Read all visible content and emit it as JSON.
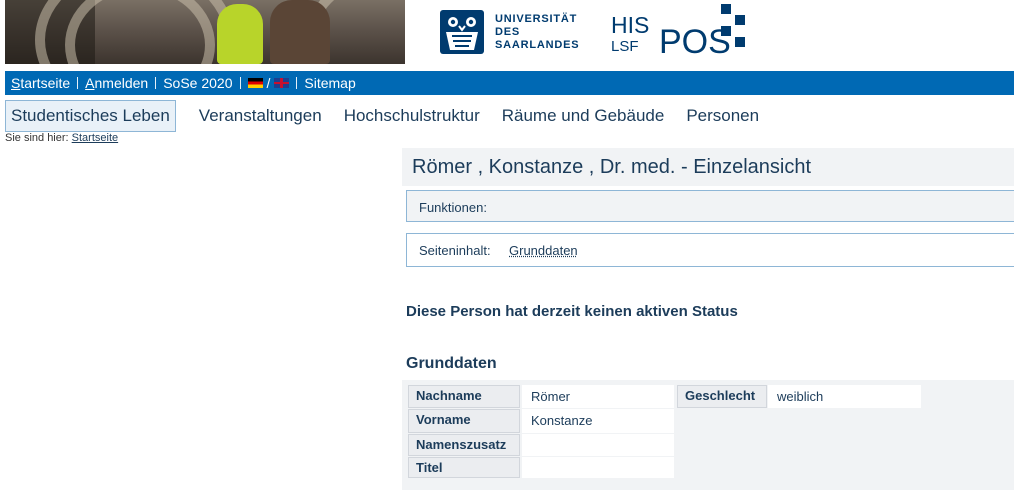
{
  "header": {
    "university_name_lines": [
      "UNIVERSITÄT",
      "DES",
      "SAARLANDES"
    ],
    "system_logo": {
      "his": "HIS",
      "lsf": "LSF",
      "pos": "POS"
    }
  },
  "topnav": {
    "home": {
      "first": "S",
      "rest": "tartseite"
    },
    "login": {
      "first": "A",
      "rest": "nmelden"
    },
    "semester": "SoSe 2020",
    "language_separator": "/",
    "sitemap": "Sitemap"
  },
  "mainnav": {
    "tabs": [
      "Studentisches Leben",
      "Veranstaltungen",
      "Hochschulstruktur",
      "Räume und Gebäude",
      "Personen"
    ]
  },
  "breadcrumb": {
    "prefix": "Sie sind hier:",
    "link": "Startseite"
  },
  "page": {
    "title": "Römer , Konstanze , Dr. med. - Einzelansicht",
    "functions_label": "Funktionen:",
    "content_label": "Seiteninhalt:",
    "content_link": "Grunddaten",
    "status_text": "Diese Person hat derzeit keinen aktiven Status",
    "section_heading": "Grunddaten"
  },
  "grunddaten": {
    "nachname_label": "Nachname",
    "nachname_value": "Römer",
    "vorname_label": "Vorname",
    "vorname_value": "Konstanze",
    "namenszusatz_label": "Namenszusatz",
    "namenszusatz_value": "",
    "titel_label": "Titel",
    "titel_value": "",
    "geschlecht_label": "Geschlecht",
    "geschlecht_value": "weiblich"
  },
  "colors": {
    "nav_blue": "#0069b4",
    "text_dark_blue": "#1c3c5a",
    "logo_blue": "#003b6f",
    "panel_gray": "#f1f3f5",
    "border_light_blue": "#8eb6d6"
  },
  "icons": [
    "university-crest-icon",
    "flag-de-icon",
    "flag-uk-icon"
  ]
}
